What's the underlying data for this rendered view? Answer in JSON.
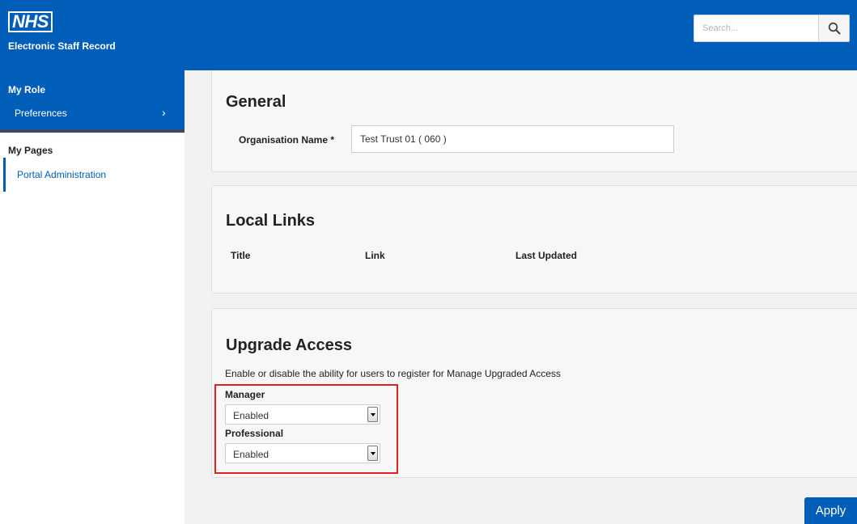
{
  "header": {
    "logo_text": "NHS",
    "app_title": "Electronic Staff Record",
    "search_placeholder": "Search...",
    "search_icon": "magnifier-icon"
  },
  "sidebar": {
    "my_role_title": "My Role",
    "my_role_items": [
      {
        "label": "Preferences",
        "icon": "chevron-right-icon",
        "chevron": "›"
      }
    ],
    "my_pages_title": "My Pages",
    "my_pages_items": [
      {
        "label": "Portal Administration"
      }
    ]
  },
  "general": {
    "title": "General",
    "org_label": "Organisation Name *",
    "org_value": "Test Trust 01 ( 060 )"
  },
  "local_links": {
    "title": "Local Links",
    "columns": [
      "Title",
      "Link",
      "Last Updated"
    ]
  },
  "upgrade_access": {
    "title": "Upgrade Access",
    "description": "Enable or disable the ability for users to register for Manage Upgraded Access",
    "fields": [
      {
        "label": "Manager",
        "value": "Enabled"
      },
      {
        "label": "Professional",
        "value": "Enabled"
      }
    ],
    "highlight_color": "#e0231e"
  },
  "actions": {
    "apply_label": "Apply"
  },
  "colors": {
    "brand": "#005eb8",
    "content_bg": "#f2f2f2",
    "panel_bg": "#f7f7f7"
  }
}
